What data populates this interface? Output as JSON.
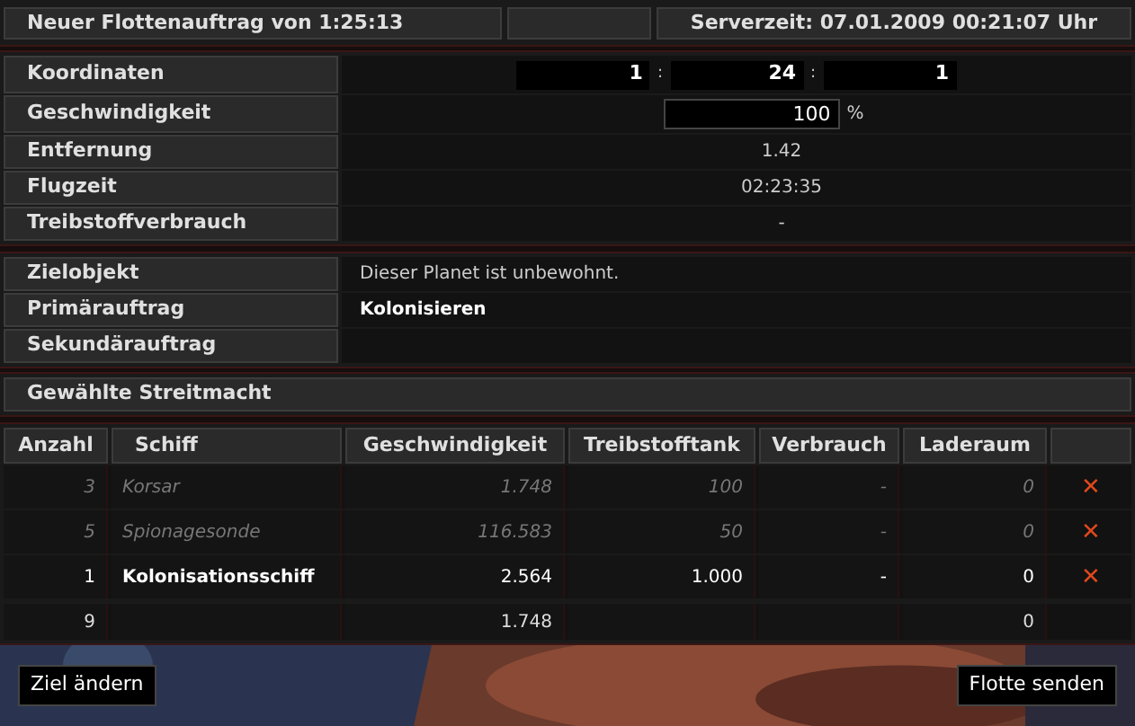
{
  "header": {
    "title": "Neuer Flottenauftrag von 1:25:13",
    "server_time": "Serverzeit: 07.01.2009 00:21:07 Uhr"
  },
  "coordinates": {
    "label": "Koordinaten",
    "values": [
      "1",
      "24",
      "1"
    ],
    "separator": ":"
  },
  "speed": {
    "label": "Geschwindigkeit",
    "value": "100",
    "unit": "%"
  },
  "info_rows": [
    {
      "label": "Entfernung",
      "value": "1.42"
    },
    {
      "label": "Flugzeit",
      "value": "02:23:35"
    },
    {
      "label": "Treibstoffverbrauch",
      "value": "-"
    }
  ],
  "mission_rows": [
    {
      "label": "Zielobjekt",
      "value": "Dieser Planet ist unbewohnt.",
      "bold": false
    },
    {
      "label": "Primärauftrag",
      "value": "Kolonisieren",
      "bold": true
    },
    {
      "label": "Sekundärauftrag"
    }
  ],
  "fleet_title": "Gewählte Streitmacht",
  "table": {
    "columns": [
      "Anzahl",
      "Schiff",
      "Geschwindigkeit",
      "Treibstofftank",
      "Verbrauch",
      "Laderaum"
    ],
    "rows": [
      {
        "count": "3",
        "ship": "Korsar",
        "speed": "1.748",
        "tank": "100",
        "consumption": "-",
        "cargo": "0",
        "disabled": true,
        "remove": "✕"
      },
      {
        "count": "5",
        "ship": "Spionagesonde",
        "speed": "116.583",
        "tank": "50",
        "consumption": "-",
        "cargo": "0",
        "disabled": true,
        "remove": "✕"
      },
      {
        "count": "1",
        "ship": "Kolonisationsschiff",
        "speed": "2.564",
        "tank": "1.000",
        "consumption": "-",
        "cargo": "0",
        "disabled": false,
        "remove": "✕"
      }
    ],
    "totals": {
      "count": "9",
      "speed": "1.748",
      "cargo": "0"
    }
  },
  "buttons": {
    "back": "Ziel ändern",
    "send": "Flotte senden"
  }
}
